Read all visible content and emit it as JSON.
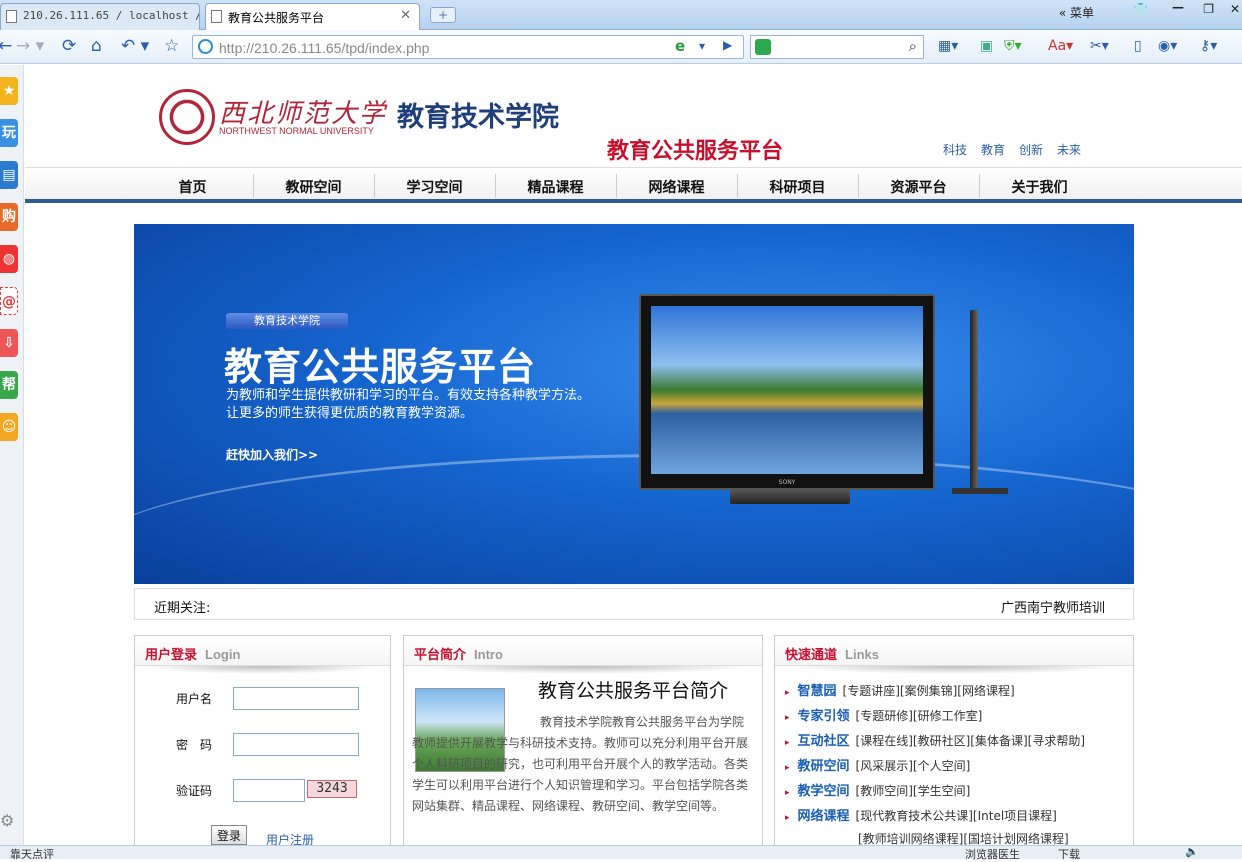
{
  "browser": {
    "tabs": [
      {
        "label": "210.26.111.65 / localhost / "
      },
      {
        "label": "教育公共服务平台"
      }
    ],
    "new_tab": "+",
    "menu_label": "« 菜单",
    "address": "http://210.26.111.65/tpd/index.php",
    "status_left": "靠天点评",
    "status_right1": "浏览器医生",
    "status_right2": "下载"
  },
  "site": {
    "univ_cn": "西北师范大学",
    "univ_en": "NORTHWEST NORMAL UNIVERSITY",
    "college": "教育技术学院",
    "platform": "教育公共服务平台",
    "toplinks": [
      "科技",
      "教育",
      "创新",
      "未来"
    ],
    "nav": [
      "首页",
      "教研空间",
      "学习空间",
      "精品课程",
      "网络课程",
      "科研项目",
      "资源平台",
      "关于我们"
    ]
  },
  "banner": {
    "pill": "教育技术学院",
    "title": "教育公共服务平台",
    "desc1": "为教师和学生提供教研和学习的平台。有效支持各种教学方法。",
    "desc2": "让更多的师生获得更优质的教育教学资源。",
    "join": "赶快加入我们>>",
    "tv_brand": "SONY"
  },
  "notice": {
    "label": "近期关注:",
    "item": "广西南宁教师培训"
  },
  "login": {
    "title_cn": "用户登录",
    "title_en": "Login",
    "username_label": "用户名",
    "password_label": "密　码",
    "captcha_label": "验证码",
    "captcha": "3243",
    "submit": "登录",
    "register": "用户注册"
  },
  "intro": {
    "title_cn": "平台简介",
    "title_en": "Intro",
    "heading": "教育公共服务平台简介",
    "text": "教育技术学院教育公共服务平台为学院教师提供开展教学与科研技术支持。教师可以充分利用平台开展个人科研项目的研究，也可利用平台开展个人的教学活动。各类学生可以利用平台进行个人知识管理和学习。平台包括学院各类网站集群、精品课程、网络课程、教研空间、教学空间等。"
  },
  "links": {
    "title_cn": "快速通道",
    "title_en": "Links",
    "rows": [
      {
        "cat": "智慧园",
        "items": "[专题讲座][案例集锦][网络课程]"
      },
      {
        "cat": "专家引领",
        "items": "[专题研修][研修工作室]"
      },
      {
        "cat": "互动社区",
        "items": "[课程在线][教研社区][集体备课][寻求帮助]"
      },
      {
        "cat": "教研空间",
        "items": "[风采展示][个人空间]"
      },
      {
        "cat": "教学空间",
        "items": "[教师空间][学生空间]"
      },
      {
        "cat": "网络课程",
        "items": "[现代教育技术公共课][Intel项目课程]"
      },
      {
        "cat": "",
        "items": "[教师培训网络课程][国培计划网络课程]"
      }
    ]
  }
}
